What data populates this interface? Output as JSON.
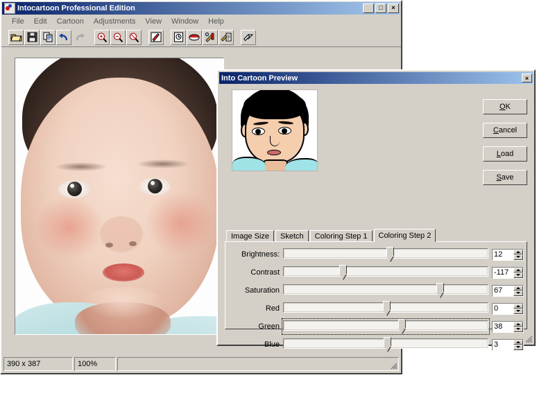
{
  "app": {
    "title": "Intocartoon Professional Edition",
    "icon": "app-logo-icon",
    "window_buttons": [
      {
        "name": "minimize",
        "glyph": "_"
      },
      {
        "name": "maximize",
        "glyph": "□"
      },
      {
        "name": "close",
        "glyph": "×"
      }
    ],
    "menus": [
      "File",
      "Edit",
      "Cartoon",
      "Adjustments",
      "View",
      "Window",
      "Help"
    ],
    "toolbar": [
      {
        "name": "open-icon",
        "title": "Open"
      },
      {
        "name": "save-icon",
        "title": "Save"
      },
      {
        "name": "copy-icon",
        "title": "Copy"
      },
      {
        "name": "undo-icon",
        "title": "Undo"
      },
      {
        "name": "redo-icon",
        "title": "Redo"
      },
      {
        "name": "zoom-in-icon",
        "title": "Zoom In"
      },
      {
        "name": "zoom-out-icon",
        "title": "Zoom Out"
      },
      {
        "name": "zoom-reset-icon",
        "title": "Zoom Reset"
      },
      {
        "name": "cartoon-brush-icon",
        "title": "Cartoon"
      },
      {
        "name": "batch-clock-icon",
        "title": "Batch"
      },
      {
        "name": "print-icon",
        "title": "Print"
      },
      {
        "name": "tools-icon",
        "title": "Tools"
      },
      {
        "name": "settings-list-icon",
        "title": "Settings"
      },
      {
        "name": "eraser-icon",
        "title": "Eraser"
      }
    ],
    "statusbar": {
      "size": "390 x 387",
      "zoom": "100%",
      "message": ""
    }
  },
  "dialog": {
    "title": "Into Cartoon Preview",
    "close_glyph": "×",
    "buttons": [
      {
        "name": "ok-button",
        "label": "OK",
        "accel": "O"
      },
      {
        "name": "cancel-button",
        "label": "Cancel",
        "accel": "C"
      },
      {
        "name": "load-button",
        "label": "Load",
        "accel": "L"
      },
      {
        "name": "save-button",
        "label": "Save",
        "accel": "S"
      }
    ],
    "tabs": [
      {
        "label": "Image Size",
        "active": false
      },
      {
        "label": "Sketch",
        "active": false
      },
      {
        "label": "Coloring Step 1",
        "active": false
      },
      {
        "label": "Coloring Step 2",
        "active": true
      }
    ],
    "sliders": [
      {
        "name": "brightness",
        "label": "Brightness:",
        "value": "12",
        "pos_pct": 50.5,
        "focused": false
      },
      {
        "name": "contrast",
        "label": "Contrast",
        "value": "-117",
        "pos_pct": 27.5,
        "focused": false
      },
      {
        "name": "saturation",
        "label": "Saturation",
        "value": "67",
        "pos_pct": 74.5,
        "focused": false
      },
      {
        "name": "red",
        "label": "Red",
        "value": "0",
        "pos_pct": 48.5,
        "focused": false
      },
      {
        "name": "green",
        "label": "Green",
        "value": "38",
        "pos_pct": 56.0,
        "focused": true
      },
      {
        "name": "blue",
        "label": "Blue",
        "value": "3",
        "pos_pct": 49.0,
        "focused": false
      }
    ]
  }
}
